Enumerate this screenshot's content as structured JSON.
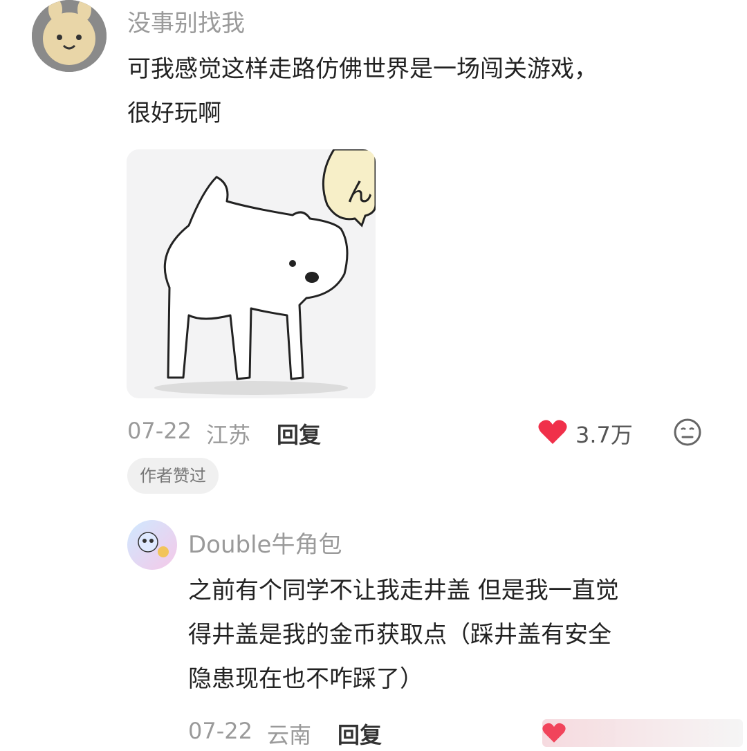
{
  "comment": {
    "username": "没事别找我",
    "text_line1": "可我感觉这样走路仿佛世界是一场闯关游戏，",
    "text_line2": "很好玩啊",
    "sticker_text": "ん?",
    "date": "07-22",
    "location": "江苏",
    "reply_label": "回复",
    "like_count": "3.7万",
    "author_badge": "作者赞过",
    "like_icon": "heart-icon",
    "like_color": "#f0304a",
    "dislike_icon": "meh-face-icon"
  },
  "reply": {
    "username": "Double牛角包",
    "text_line1": "之前有个同学不让我走井盖 但是我一直觉",
    "text_line2": "得井盖是我的金币获取点（踩井盖有安全",
    "text_line3": "隐患现在也不咋踩了）",
    "date": "07-22",
    "location": "云南",
    "reply_label": "回复"
  }
}
